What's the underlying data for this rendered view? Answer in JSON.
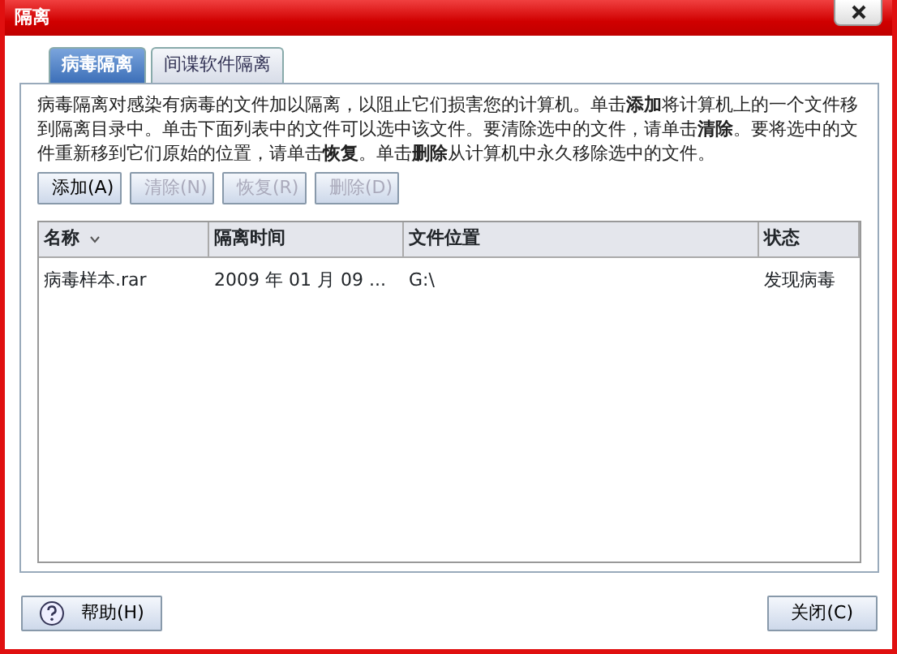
{
  "window": {
    "title": "隔离"
  },
  "tabs": [
    {
      "label": "病毒隔离",
      "selected": true
    },
    {
      "label": "间谍软件隔离",
      "selected": false
    }
  ],
  "description": "病毒隔离对感染有病毒的文件加以隔离，以阻止它们损害您的计算机。单击**添加**将计算机上的一个文件移到隔离目录中。单击下面列表中的文件可以选中该文件。要清除选中的文件，请单击**清除**。要将选中的文件重新移到它们原始的位置，请单击**恢复**。单击**删除**从计算机中永久移除选中的文件。",
  "actions": [
    {
      "label": "添加(A)",
      "disabled": false
    },
    {
      "label": "清除(N)",
      "disabled": true
    },
    {
      "label": "恢复(R)",
      "disabled": true
    },
    {
      "label": "删除(D)",
      "disabled": true
    }
  ],
  "table": {
    "columns": [
      {
        "label": "名称",
        "sorted": true
      },
      {
        "label": "隔离时间",
        "sorted": false
      },
      {
        "label": "文件位置",
        "sorted": false
      },
      {
        "label": "状态",
        "sorted": false
      }
    ],
    "rows": [
      [
        "病毒样本.rar",
        "2009 年 01 月 09 ...",
        "G:\\",
        "发现病毒"
      ]
    ]
  },
  "footer": {
    "help": "帮助(H)",
    "close": "关闭(C)"
  }
}
